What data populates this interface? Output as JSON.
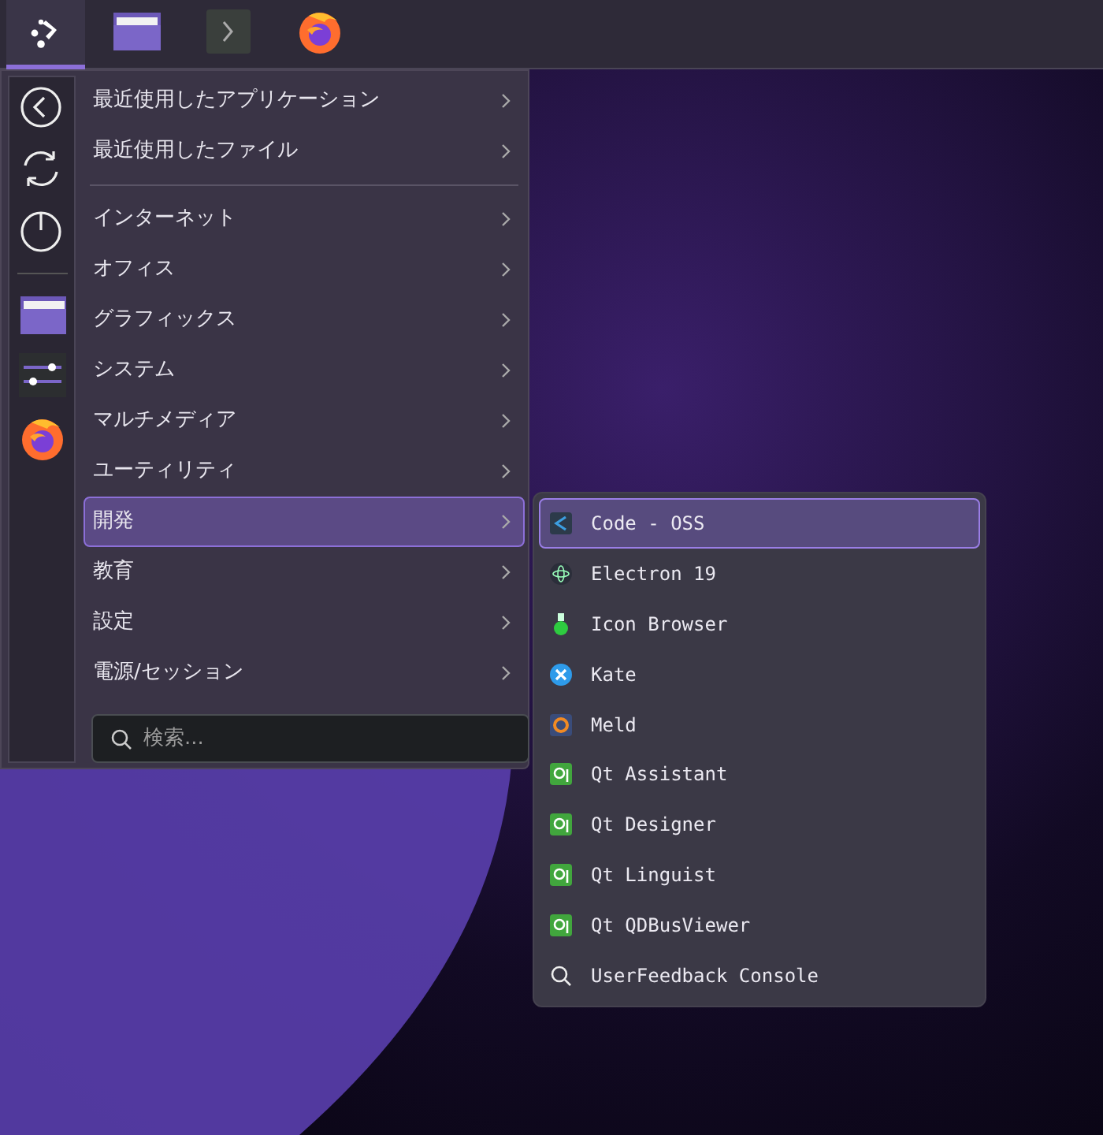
{
  "panel": {
    "tasks": [
      {
        "kind": "launcher",
        "selected": true
      },
      {
        "kind": "folder",
        "selected": false
      },
      {
        "kind": "terminal",
        "selected": false
      },
      {
        "kind": "firefox",
        "selected": false
      }
    ]
  },
  "menu": {
    "sidebar": [
      {
        "kind": "back"
      },
      {
        "kind": "switch"
      },
      {
        "kind": "power"
      },
      {
        "kind": "separator"
      },
      {
        "kind": "folder"
      },
      {
        "kind": "settings"
      },
      {
        "kind": "firefox"
      }
    ],
    "recent": [
      {
        "label": "最近使用したアプリケーション",
        "selected": false
      },
      {
        "label": "最近使用したファイル",
        "selected": false
      }
    ],
    "categories": [
      {
        "label": "インターネット",
        "selected": false
      },
      {
        "label": "オフィス",
        "selected": false
      },
      {
        "label": "グラフィックス",
        "selected": false
      },
      {
        "label": "システム",
        "selected": false
      },
      {
        "label": "マルチメディア",
        "selected": false
      },
      {
        "label": "ユーティリティ",
        "selected": false
      },
      {
        "label": "開発",
        "selected": true
      },
      {
        "label": "教育",
        "selected": false
      },
      {
        "label": "設定",
        "selected": false
      },
      {
        "label": "電源/セッション",
        "selected": false
      }
    ],
    "search": {
      "placeholder": "検索..."
    },
    "submenu": [
      {
        "label": "Code - OSS",
        "kind": "code",
        "selected": true
      },
      {
        "label": "Electron 19",
        "kind": "electron",
        "selected": false
      },
      {
        "label": "Icon Browser",
        "kind": "flask",
        "selected": false
      },
      {
        "label": "Kate",
        "kind": "kate",
        "selected": false
      },
      {
        "label": "Meld",
        "kind": "meld",
        "selected": false
      },
      {
        "label": "Qt Assistant",
        "kind": "qt",
        "selected": false
      },
      {
        "label": "Qt Designer",
        "kind": "qt",
        "selected": false
      },
      {
        "label": "Qt Linguist",
        "kind": "qt",
        "selected": false
      },
      {
        "label": "Qt QDBusViewer",
        "kind": "qt",
        "selected": false
      },
      {
        "label": "UserFeedback Console",
        "kind": "search",
        "selected": false
      }
    ]
  }
}
